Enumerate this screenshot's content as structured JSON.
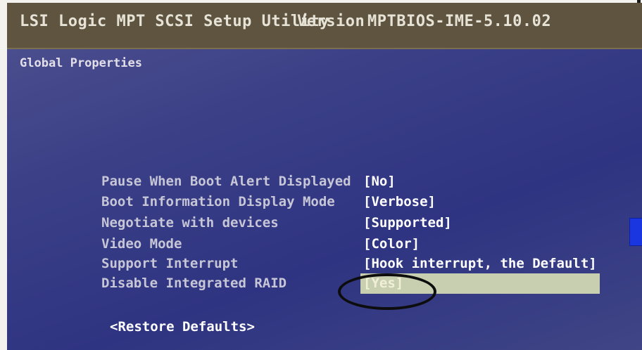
{
  "header": {
    "app_title": "LSI Logic MPT SCSI Setup Utility",
    "version_label": "Version",
    "version_value": "MPTBIOS-IME-5.10.02"
  },
  "section": {
    "title": "Global Properties"
  },
  "settings": [
    {
      "label": "Pause When Boot Alert Displayed",
      "value": "[No]"
    },
    {
      "label": "Boot Information Display Mode",
      "value": "[Verbose]"
    },
    {
      "label": "Negotiate with devices",
      "value": "[Supported]"
    },
    {
      "label": "Video Mode",
      "value": "[Color]"
    },
    {
      "label": "Support Interrupt",
      "value": "[Hook interrupt, the Default]"
    },
    {
      "label": "Disable Integrated RAID",
      "value": "[Yes]",
      "selected": true
    }
  ],
  "actions": {
    "restore_defaults": "<Restore Defaults>"
  },
  "colors": {
    "screen_bg": "#3a3f86",
    "title_bar": "#5e5440",
    "selection_highlight": "#c8cfb0",
    "annotation_circle": "#0d0d0d"
  }
}
